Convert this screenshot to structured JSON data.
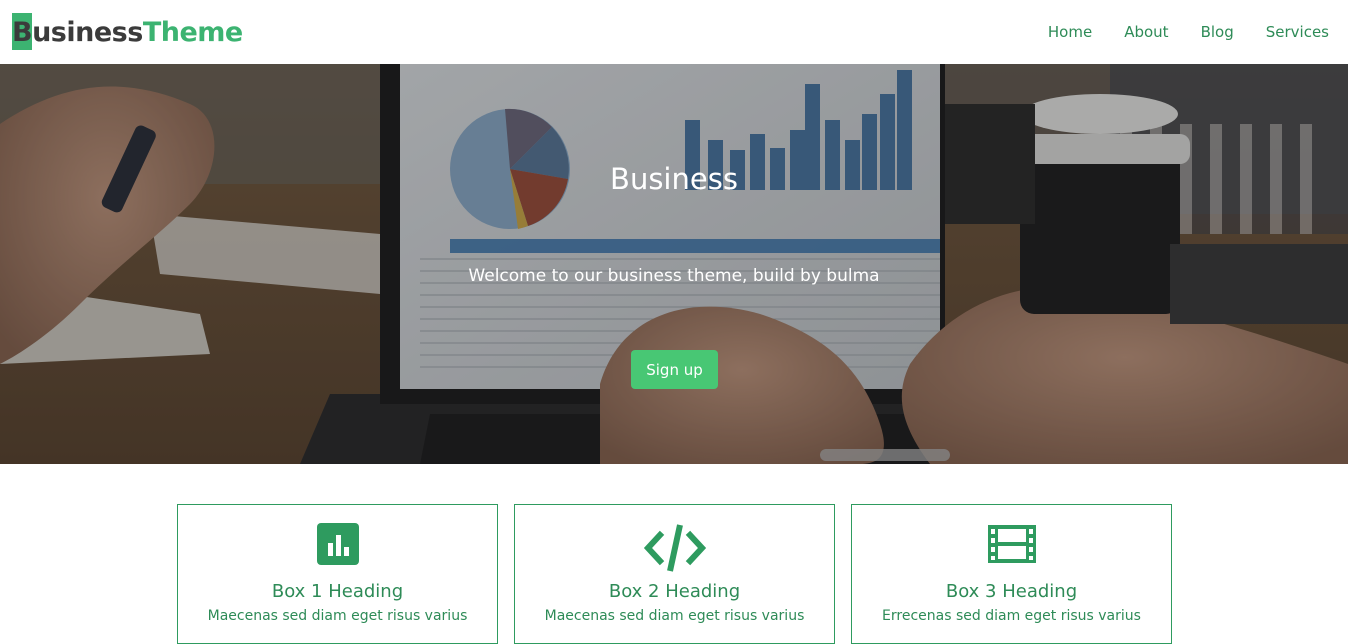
{
  "navbar": {
    "brand_first": "Business",
    "brand_second": "Theme",
    "links": [
      "Home",
      "About",
      "Blog",
      "Services"
    ]
  },
  "hero": {
    "title": "Business",
    "subtitle": "Welcome to our business theme, build by bulma",
    "button_label": "Sign up"
  },
  "boxes": [
    {
      "icon": "bar-chart-icon",
      "heading": "Box 1 Heading",
      "text": "Maecenas sed diam eget risus varius"
    },
    {
      "icon": "code-icon",
      "heading": "Box 2 Heading",
      "text": "Maecenas sed diam eget risus varius"
    },
    {
      "icon": "film-icon",
      "heading": "Box 3 Heading",
      "text": "Errecenas sed diam eget risus varius"
    }
  ],
  "colors": {
    "primary": "#48c774",
    "brand_green": "#3cb371",
    "link_green": "#2e8b57",
    "brand_dark": "#3b3b3b"
  }
}
